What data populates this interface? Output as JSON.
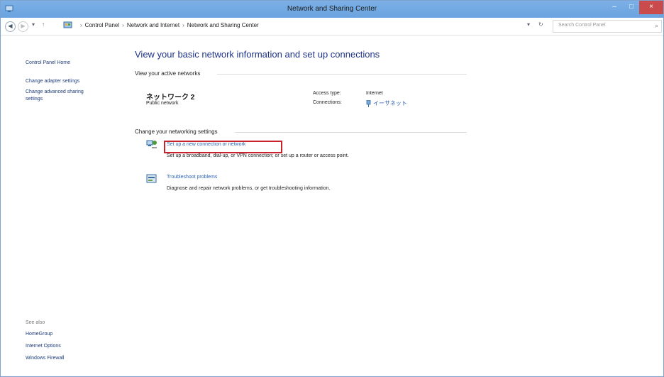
{
  "window": {
    "title": "Network and Sharing Center",
    "minimize": "–",
    "maximize": "□",
    "close": "×"
  },
  "address": {
    "back": "◀",
    "forward": "▶",
    "history": "▾",
    "up": "↑",
    "crumbs": [
      "Control Panel",
      "Network and Internet",
      "Network and Sharing Center"
    ],
    "separator": "›",
    "dropdown": "▾",
    "refresh": "↻",
    "search_placeholder": "Search Control Panel",
    "search_icon": "⌕"
  },
  "sidebar": {
    "home": "Control Panel Home",
    "links": [
      "Change adapter settings",
      "Change advanced sharing",
      "settings"
    ],
    "see_also": "See also",
    "see_also_links": [
      "HomeGroup",
      "Internet Options",
      "Windows Firewall"
    ]
  },
  "main": {
    "title": "View your basic network information and set up connections",
    "active_label": "View your active networks",
    "network_name": "ネットワーク 2",
    "network_type": "Public network",
    "access_label": "Access type:",
    "access_value": "Internet",
    "connections_label": "Connections:",
    "connection_name": "イーサネット",
    "change_label": "Change your networking settings",
    "tasks": [
      {
        "link": "Set up a new connection or network",
        "desc": "Set up a broadband, dial-up, or VPN connection; or set up a router or access point.",
        "icon": "network-setup-icon"
      },
      {
        "link": "Troubleshoot problems",
        "desc": "Diagnose and repair network problems, or get troubleshooting information.",
        "icon": "troubleshoot-icon"
      }
    ]
  },
  "colors": {
    "titlebar": "#6aa3df",
    "close_button": "#c94b4b",
    "highlight_box": "#c8232c",
    "link": "#2b63b6",
    "heading": "#1e3287"
  }
}
